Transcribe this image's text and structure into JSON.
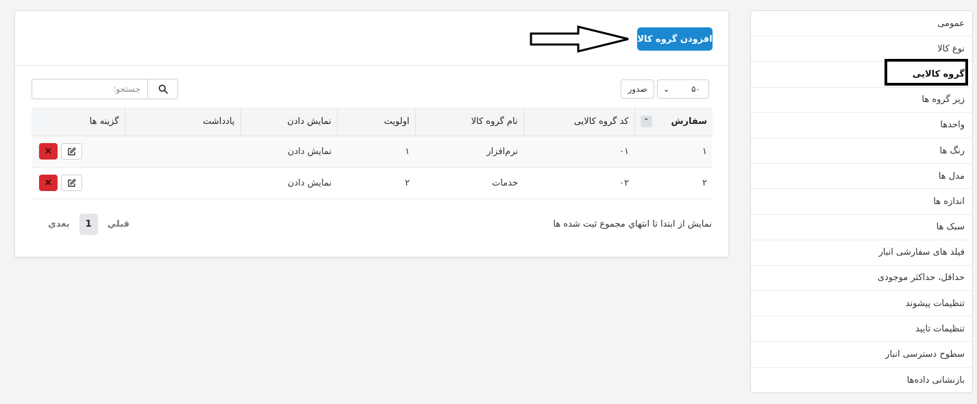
{
  "sidebar": {
    "items": [
      {
        "label": "عمومی"
      },
      {
        "label": "نوع کالا"
      },
      {
        "label": "گروه کالایی"
      },
      {
        "label": "زیر گروه ها"
      },
      {
        "label": "واحدها"
      },
      {
        "label": "رنگ ها"
      },
      {
        "label": "مدل ها"
      },
      {
        "label": "اندازه ها"
      },
      {
        "label": "سبک ها"
      },
      {
        "label": "فیلد های سفارشی انبار"
      },
      {
        "label": "حداقل، حداکثر موجودی"
      },
      {
        "label": "تنظیمات پیشوند"
      },
      {
        "label": "تنظیمات تایید"
      },
      {
        "label": "سطوح دسترسی انبار"
      },
      {
        "label": "بازنشانی داده‌ها"
      }
    ],
    "active_index": 2
  },
  "header": {
    "add_button_label": "افزودن گروه کالا"
  },
  "toolbar": {
    "export_label": "صدور",
    "page_size": "۵۰",
    "search_placeholder": "جستجو:"
  },
  "table": {
    "columns": [
      "سفارش",
      "کد گروه کالایی",
      "نام گروه کالا",
      "اولویت",
      "نمایش دادن",
      "یادداشت",
      "گزینه ها"
    ],
    "rows": [
      {
        "order": "۱",
        "code": "۰۱",
        "name": "نرم‌افزار",
        "priority": "۱",
        "display": "نمایش دادن",
        "note": ""
      },
      {
        "order": "۲",
        "code": "۰۲",
        "name": "خدمات",
        "priority": "۲",
        "display": "نمایش دادن",
        "note": ""
      }
    ]
  },
  "footer": {
    "info": "نمایش از ابتدا تا انتهاي مجموع ثبت شده ها",
    "prev_label": "قبلي",
    "current_page": "1",
    "next_label": "بعدي"
  },
  "colors": {
    "primary": "#1b88d0",
    "danger": "#d9282f",
    "background": "#f4f4f4"
  }
}
